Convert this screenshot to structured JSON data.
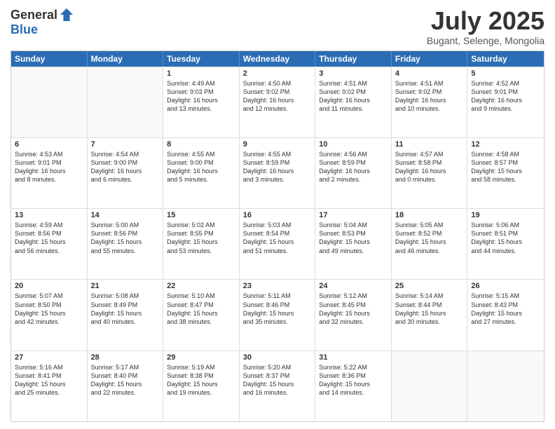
{
  "logo": {
    "general": "General",
    "blue": "Blue"
  },
  "title": "July 2025",
  "subtitle": "Bugant, Selenge, Mongolia",
  "weekdays": [
    "Sunday",
    "Monday",
    "Tuesday",
    "Wednesday",
    "Thursday",
    "Friday",
    "Saturday"
  ],
  "weeks": [
    [
      {
        "day": "",
        "info": ""
      },
      {
        "day": "",
        "info": ""
      },
      {
        "day": "1",
        "info": "Sunrise: 4:49 AM\nSunset: 9:03 PM\nDaylight: 16 hours\nand 13 minutes."
      },
      {
        "day": "2",
        "info": "Sunrise: 4:50 AM\nSunset: 9:02 PM\nDaylight: 16 hours\nand 12 minutes."
      },
      {
        "day": "3",
        "info": "Sunrise: 4:51 AM\nSunset: 9:02 PM\nDaylight: 16 hours\nand 11 minutes."
      },
      {
        "day": "4",
        "info": "Sunrise: 4:51 AM\nSunset: 9:02 PM\nDaylight: 16 hours\nand 10 minutes."
      },
      {
        "day": "5",
        "info": "Sunrise: 4:52 AM\nSunset: 9:01 PM\nDaylight: 16 hours\nand 9 minutes."
      }
    ],
    [
      {
        "day": "6",
        "info": "Sunrise: 4:53 AM\nSunset: 9:01 PM\nDaylight: 16 hours\nand 8 minutes."
      },
      {
        "day": "7",
        "info": "Sunrise: 4:54 AM\nSunset: 9:00 PM\nDaylight: 16 hours\nand 6 minutes."
      },
      {
        "day": "8",
        "info": "Sunrise: 4:55 AM\nSunset: 9:00 PM\nDaylight: 16 hours\nand 5 minutes."
      },
      {
        "day": "9",
        "info": "Sunrise: 4:55 AM\nSunset: 8:59 PM\nDaylight: 16 hours\nand 3 minutes."
      },
      {
        "day": "10",
        "info": "Sunrise: 4:56 AM\nSunset: 8:59 PM\nDaylight: 16 hours\nand 2 minutes."
      },
      {
        "day": "11",
        "info": "Sunrise: 4:57 AM\nSunset: 8:58 PM\nDaylight: 16 hours\nand 0 minutes."
      },
      {
        "day": "12",
        "info": "Sunrise: 4:58 AM\nSunset: 8:57 PM\nDaylight: 15 hours\nand 58 minutes."
      }
    ],
    [
      {
        "day": "13",
        "info": "Sunrise: 4:59 AM\nSunset: 8:56 PM\nDaylight: 15 hours\nand 56 minutes."
      },
      {
        "day": "14",
        "info": "Sunrise: 5:00 AM\nSunset: 8:56 PM\nDaylight: 15 hours\nand 55 minutes."
      },
      {
        "day": "15",
        "info": "Sunrise: 5:02 AM\nSunset: 8:55 PM\nDaylight: 15 hours\nand 53 minutes."
      },
      {
        "day": "16",
        "info": "Sunrise: 5:03 AM\nSunset: 8:54 PM\nDaylight: 15 hours\nand 51 minutes."
      },
      {
        "day": "17",
        "info": "Sunrise: 5:04 AM\nSunset: 8:53 PM\nDaylight: 15 hours\nand 49 minutes."
      },
      {
        "day": "18",
        "info": "Sunrise: 5:05 AM\nSunset: 8:52 PM\nDaylight: 15 hours\nand 46 minutes."
      },
      {
        "day": "19",
        "info": "Sunrise: 5:06 AM\nSunset: 8:51 PM\nDaylight: 15 hours\nand 44 minutes."
      }
    ],
    [
      {
        "day": "20",
        "info": "Sunrise: 5:07 AM\nSunset: 8:50 PM\nDaylight: 15 hours\nand 42 minutes."
      },
      {
        "day": "21",
        "info": "Sunrise: 5:08 AM\nSunset: 8:49 PM\nDaylight: 15 hours\nand 40 minutes."
      },
      {
        "day": "22",
        "info": "Sunrise: 5:10 AM\nSunset: 8:47 PM\nDaylight: 15 hours\nand 38 minutes."
      },
      {
        "day": "23",
        "info": "Sunrise: 5:11 AM\nSunset: 8:46 PM\nDaylight: 15 hours\nand 35 minutes."
      },
      {
        "day": "24",
        "info": "Sunrise: 5:12 AM\nSunset: 8:45 PM\nDaylight: 15 hours\nand 32 minutes."
      },
      {
        "day": "25",
        "info": "Sunrise: 5:14 AM\nSunset: 8:44 PM\nDaylight: 15 hours\nand 30 minutes."
      },
      {
        "day": "26",
        "info": "Sunrise: 5:15 AM\nSunset: 8:43 PM\nDaylight: 15 hours\nand 27 minutes."
      }
    ],
    [
      {
        "day": "27",
        "info": "Sunrise: 5:16 AM\nSunset: 8:41 PM\nDaylight: 15 hours\nand 25 minutes."
      },
      {
        "day": "28",
        "info": "Sunrise: 5:17 AM\nSunset: 8:40 PM\nDaylight: 15 hours\nand 22 minutes."
      },
      {
        "day": "29",
        "info": "Sunrise: 5:19 AM\nSunset: 8:38 PM\nDaylight: 15 hours\nand 19 minutes."
      },
      {
        "day": "30",
        "info": "Sunrise: 5:20 AM\nSunset: 8:37 PM\nDaylight: 15 hours\nand 16 minutes."
      },
      {
        "day": "31",
        "info": "Sunrise: 5:22 AM\nSunset: 8:36 PM\nDaylight: 15 hours\nand 14 minutes."
      },
      {
        "day": "",
        "info": ""
      },
      {
        "day": "",
        "info": ""
      }
    ]
  ]
}
